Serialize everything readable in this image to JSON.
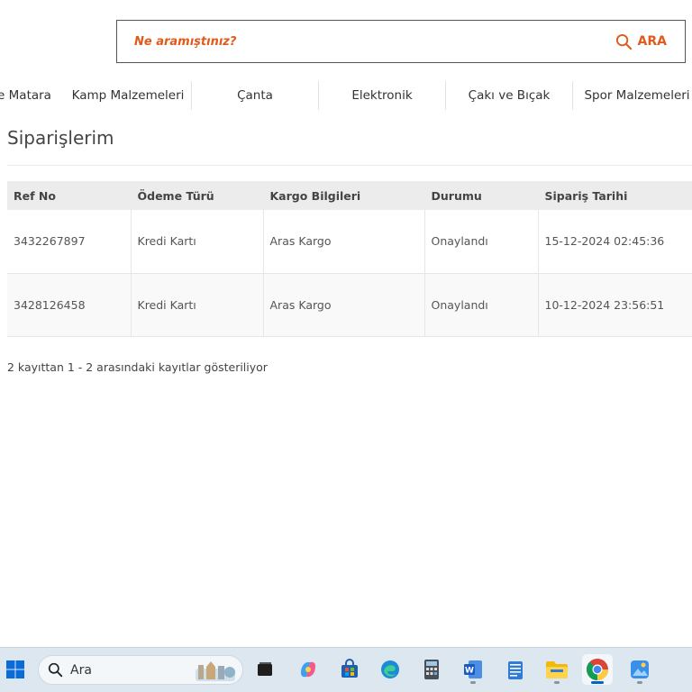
{
  "search": {
    "placeholder": "Ne aramıştınız?",
    "button_label": "ARA",
    "accent_color": "#e05a1c"
  },
  "categories": [
    {
      "label": "e Matara"
    },
    {
      "label": "Kamp Malzemeleri"
    },
    {
      "label": "Çanta"
    },
    {
      "label": "Elektronik"
    },
    {
      "label": "Çakı ve Bıçak"
    },
    {
      "label": "Spor Malzemeleri"
    }
  ],
  "page": {
    "title": "Siparişlerim"
  },
  "orders_table": {
    "headers": [
      "Ref No",
      "Ödeme Türü",
      "Kargo Bilgileri",
      "Durumu",
      "Sipariş Tarihi"
    ],
    "rows": [
      [
        "3432267897",
        "Kredi Kartı",
        "Aras Kargo",
        "Onaylandı",
        "15-12-2024 02:45:36"
      ],
      [
        "3428126458",
        "Kredi Kartı",
        "Aras Kargo",
        "Onaylandı",
        "10-12-2024 23:56:51"
      ]
    ]
  },
  "table_info": "2 kayıttan 1 - 2 arasındaki kayıtlar gösteriliyor",
  "taskbar": {
    "search_text": "Ara",
    "apps": [
      {
        "icon": "task-view-icon"
      },
      {
        "icon": "copilot-icon"
      },
      {
        "icon": "store-icon"
      },
      {
        "icon": "edge-icon"
      },
      {
        "icon": "calculator-icon"
      },
      {
        "icon": "word-icon"
      },
      {
        "icon": "notepad-icon"
      },
      {
        "icon": "file-explorer-icon"
      },
      {
        "icon": "chrome-icon"
      },
      {
        "icon": "photos-icon"
      }
    ]
  }
}
